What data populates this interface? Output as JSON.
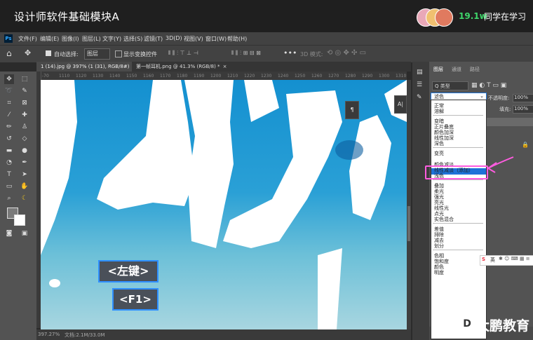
{
  "course": {
    "title": "设计师软件基础模块A",
    "learners_count": "19.1w",
    "learners_label": "同学在学习"
  },
  "ps": {
    "logo": "Ps",
    "menu": [
      "文件(F)",
      "编辑(E)",
      "图像(I)",
      "图层(L)",
      "文字(Y)",
      "选择(S)",
      "滤镜(T)",
      "3D(D)",
      "视图(V)",
      "窗口(W)",
      "帮助(H)"
    ],
    "options": {
      "auto_select_label": "自动选择:",
      "auto_select_value": "图层",
      "show_transform_label": "显示变换控件",
      "mode_3d_label": "3D 模式:"
    },
    "doc_tabs": [
      {
        "label": "1 (14).jpg @ 397% (1 (31), RGB/8#) *",
        "active": true
      },
      {
        "label": "第一帧耳机.png @ 41.3% (RGB/8) *",
        "active": false
      }
    ],
    "ruler_ticks": [
      "-70",
      "1110",
      "1120",
      "1130",
      "1140",
      "1150",
      "1160",
      "1170",
      "1180",
      "1190",
      "1200",
      "1210",
      "1220",
      "1230",
      "1240",
      "1250",
      "1260",
      "1270",
      "1280",
      "1290",
      "1300",
      "1310"
    ],
    "status": {
      "zoom": "397.27%",
      "doc": "文档:2.1M/33.0M"
    },
    "text_tool_label": "A|"
  },
  "layers_panel": {
    "tabs": [
      "图层",
      "通道",
      "路径"
    ],
    "filter_label": "Q 类型",
    "blend_mode_value": "滤色",
    "opacity_label": "不透明度:",
    "opacity_value": "100%",
    "fill_label": "填充:",
    "fill_value": "100%"
  },
  "blend_modes": {
    "groups": [
      [
        "正常",
        "溶解"
      ],
      [
        "变暗",
        "正片叠底",
        "颜色加深",
        "线性加深",
        "深色"
      ],
      [
        "变亮",
        "滤色",
        "颜色减淡",
        "线性减淡（添加）",
        "浅色"
      ],
      [
        "叠加",
        "柔光",
        "强光",
        "亮光",
        "线性光",
        "点光",
        "实色混合"
      ],
      [
        "差值",
        "排除",
        "减去",
        "划分"
      ],
      [
        "色相",
        "饱和度",
        "颜色",
        "明度"
      ]
    ],
    "selected": "滤色"
  },
  "key_hints": {
    "mouse": "<左键>",
    "key": "<F1>"
  },
  "ime": {
    "label": "英"
  },
  "watermark": {
    "logo": "D",
    "text": "大鹏教育"
  },
  "colors": {
    "accent_green": "#3fd66b",
    "selection_blue": "#1e73d8",
    "highlight_pink": "#ff5ce0",
    "key_border_blue": "#2e8fff",
    "canvas_blue": "#1a8fd0"
  }
}
